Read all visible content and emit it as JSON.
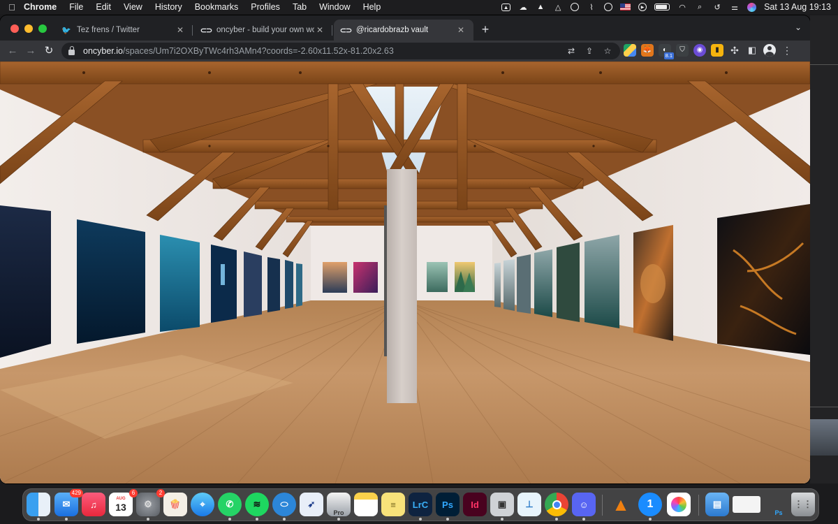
{
  "menubar": {
    "app": "Chrome",
    "menus": [
      "File",
      "Edit",
      "View",
      "History",
      "Bookmarks",
      "Profiles",
      "Tab",
      "Window",
      "Help"
    ],
    "clock": "Sat 13 Aug  19:13"
  },
  "browser": {
    "tabs": [
      {
        "title": "Tez frens / Twitter",
        "icon": "twitter-bird-icon"
      },
      {
        "title": "oncyber - build your own world",
        "icon": "link-icon"
      },
      {
        "title": "@ricardobrazb vault",
        "icon": "link-icon"
      }
    ],
    "url_host": "oncyber.io",
    "url_path": "/spaces/Um7i2OXByTWc4rh3AMn4?coords=-2.60x11.52x-81.20x2.63",
    "extension_badge": "8.1"
  },
  "dock": {
    "mail_badge": "429",
    "calendar_month": "AUG",
    "calendar_day": "13",
    "calendar_badge": "6",
    "settings_badge": "2",
    "lrc_label": "LrC",
    "ps_label": "Ps",
    "id_label": "Id",
    "pro_label": "Pro",
    "onepassword_label": "1",
    "ps_file_label": "Ps"
  },
  "colors": {
    "wall": "#efe9e5",
    "wood_floor": "#b88653",
    "roof_beam": "#9a5a28",
    "chrome_tab_active": "#35363a"
  }
}
